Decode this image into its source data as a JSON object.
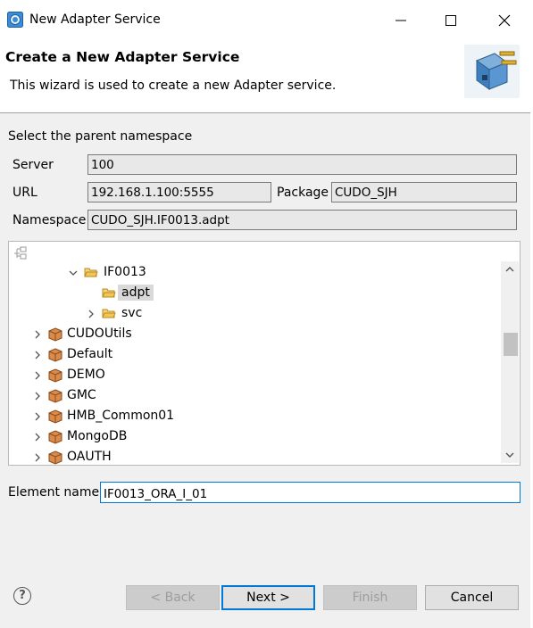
{
  "window": {
    "title": "New Adapter Service",
    "buttons": [
      "minimize",
      "maximize",
      "close"
    ]
  },
  "banner": {
    "title": "Create a New Adapter Service",
    "description": "This wizard is used to create a new Adapter service."
  },
  "form": {
    "section_label": "Select the parent namespace",
    "server_label": "Server",
    "server_value": "100",
    "url_label": "URL",
    "url_value": "192.168.1.100:5555",
    "package_label": "Package",
    "package_value": "CUDO_SJH",
    "namespace_label": "Namespace",
    "namespace_value": "CUDO_SJH.IF0013.adpt"
  },
  "tree": {
    "items": [
      {
        "label": "IF0013",
        "type": "folder",
        "expanded": true
      },
      {
        "label": "adpt",
        "type": "folder",
        "selected": true
      },
      {
        "label": "svc",
        "type": "folder",
        "expanded": false
      },
      {
        "label": "CUDOUtils",
        "type": "package"
      },
      {
        "label": "Default",
        "type": "package"
      },
      {
        "label": "DEMO",
        "type": "package"
      },
      {
        "label": "GMC",
        "type": "package"
      },
      {
        "label": "HMB_Common01",
        "type": "package"
      },
      {
        "label": "MongoDB",
        "type": "package"
      },
      {
        "label": "OAUTH",
        "type": "package"
      }
    ]
  },
  "element": {
    "label": "Element name",
    "value": "IF0013_ORA_I_01"
  },
  "buttons": {
    "back": "< Back",
    "next": "Next >",
    "finish": "Finish",
    "cancel": "Cancel",
    "help": "?"
  },
  "colors": {
    "focus": "#0078d7",
    "package_icon": "#c8763a",
    "folder_icon": "#e8b64c"
  }
}
